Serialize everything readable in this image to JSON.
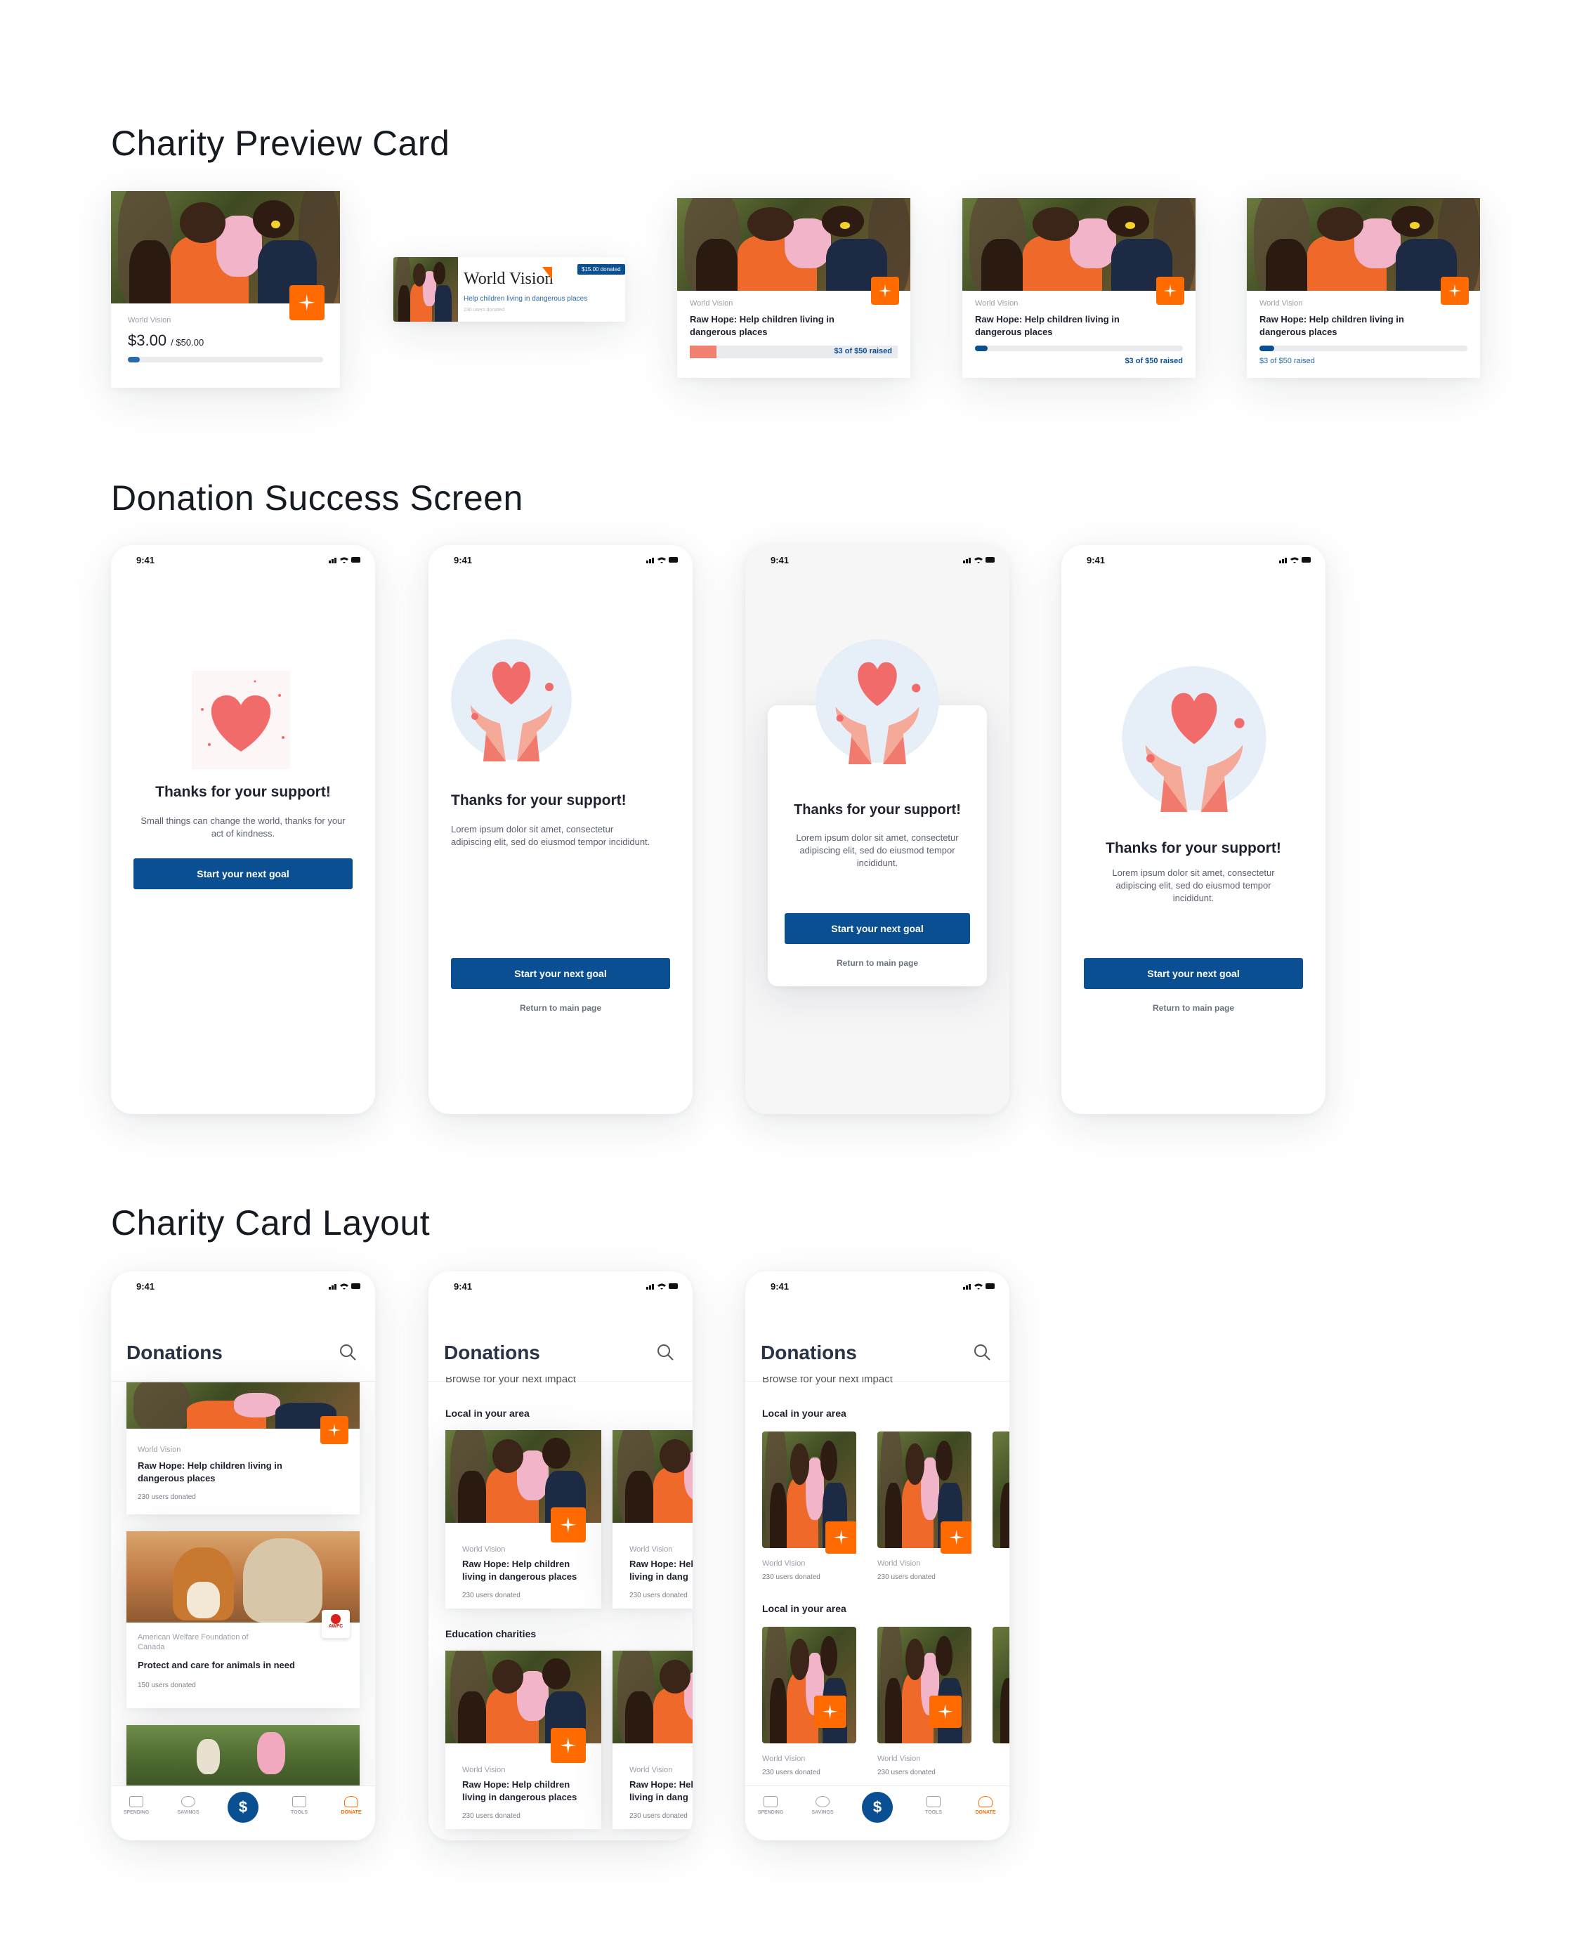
{
  "sections": {
    "preview": "Charity Preview Card",
    "success": "Donation Success Screen",
    "layout": "Charity Card Layout"
  },
  "preview_cards": {
    "card1": {
      "org": "World Vision",
      "amount": "$3.00",
      "goal": "/ $50.00",
      "progress": 0.06
    },
    "card2": {
      "org": "World Vision",
      "badge": "$15.00 donated",
      "subtitle": "Help children living in dangerous places",
      "users": "230 users donated"
    },
    "card3": {
      "org": "World Vision",
      "title": "Raw Hope: Help children living in dangerous places",
      "raised": "$3 of $50 raised",
      "progress": 0.13
    },
    "card4": {
      "org": "World Vision",
      "title": "Raw Hope: Help children living in dangerous places",
      "raised": "$3 of $50 raised",
      "progress": 0.06
    },
    "card5": {
      "org": "World Vision",
      "title": "Raw Hope: Help children living in dangerous places",
      "raised": "$3 of $50 raised",
      "progress": 0.07
    }
  },
  "status_time": "9:41",
  "success_screens": {
    "s1": {
      "title": "Thanks for your support!",
      "body": "Small things can change the world, thanks for your act of kindness.",
      "cta": "Start your next goal"
    },
    "s2": {
      "title": "Thanks for your support!",
      "body": "Lorem ipsum dolor sit amet, consectetur adipiscing elit, sed do eiusmod tempor incididunt.",
      "cta": "Start your next goal",
      "link": "Return to main page"
    },
    "s3": {
      "title": "Thanks for your support!",
      "body": "Lorem ipsum dolor sit amet, consectetur adipiscing elit, sed do eiusmod tempor incididunt.",
      "cta": "Start your next goal",
      "link": "Return to main page"
    },
    "s4": {
      "title": "Thanks for your support!",
      "body": "Lorem ipsum dolor sit amet, consectetur adipiscing elit, sed do eiusmod tempor incididunt.",
      "cta": "Start your next goal",
      "link": "Return to main page"
    }
  },
  "layout_screens": {
    "title": "Donations",
    "subtitle": "Browse for your next impact",
    "local": "Local in your area",
    "education": "Education charities",
    "wv_org": "World Vision",
    "wv_title": "Raw Hope: Help children living in dangerous places",
    "wv_users": "230 users donated",
    "wv_title_cut": "Raw Hope: Help children living in dang",
    "awfc_org": "American Welfare Foundation of Canada",
    "awfc_logo": "AWFC",
    "awfc_title": "Protect and care for animals in need",
    "awfc_users": "150 users donated",
    "nav": {
      "spending": "SPENDING",
      "savings": "SAVINGS",
      "dollar": "$",
      "tools": "TOOLS",
      "donate": "DONATE"
    }
  },
  "colors": {
    "primary": "#0b4f93",
    "accent": "#ff6b00",
    "heart": "#f26b6b",
    "progress_coral": "#f08070"
  }
}
